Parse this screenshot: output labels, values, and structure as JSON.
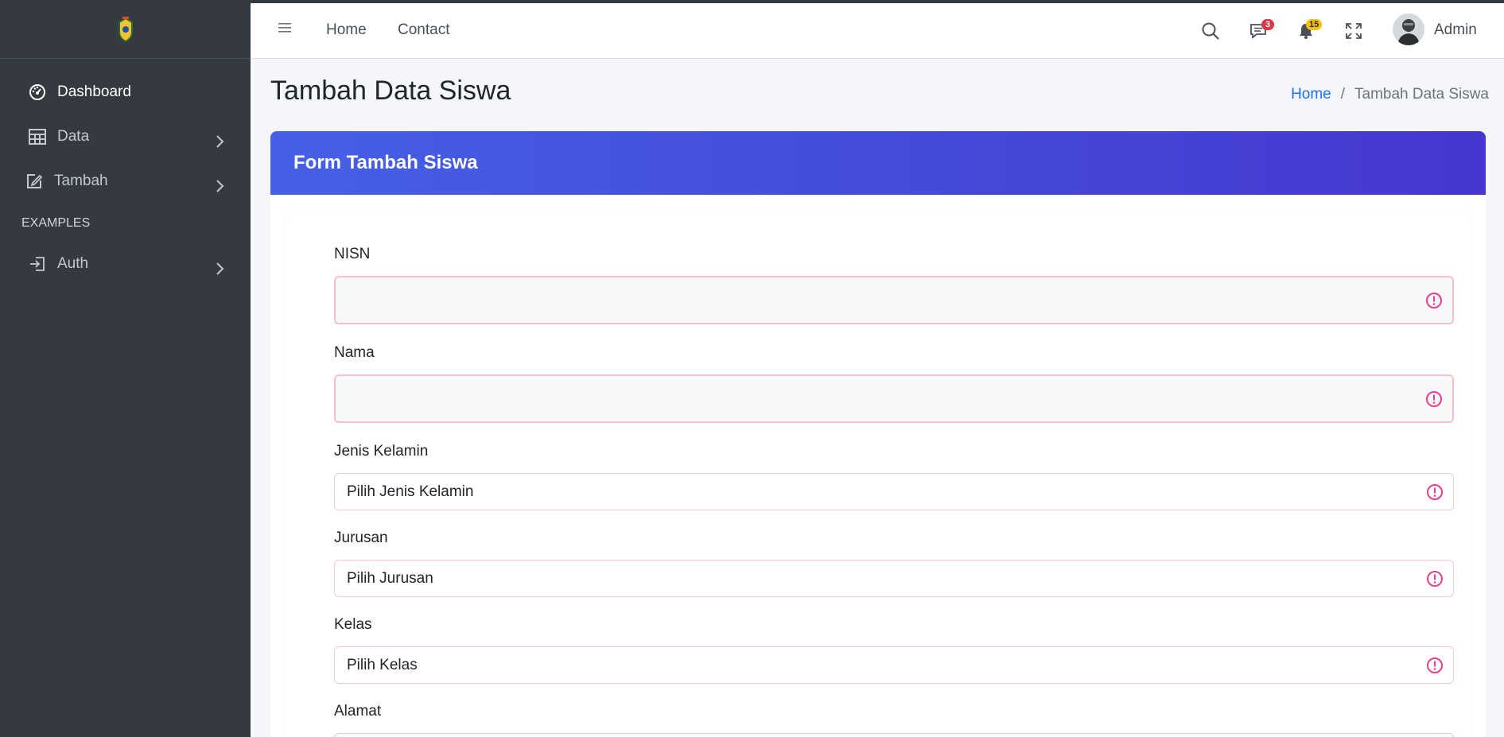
{
  "navbar": {
    "links": [
      "Home",
      "Contact"
    ],
    "messages_count": "3",
    "notifications_count": "15",
    "user_name": "Admin"
  },
  "sidebar": {
    "items": [
      {
        "label": "Dashboard",
        "icon": "dashboard-gauge-icon"
      },
      {
        "label": "Data",
        "icon": "table-icon"
      },
      {
        "label": "Tambah",
        "icon": "edit-icon"
      }
    ],
    "section_header": "EXAMPLES",
    "auth": {
      "label": "Auth",
      "icon": "login-icon"
    }
  },
  "page": {
    "title": "Tambah Data Siswa",
    "breadcrumb": {
      "home": "Home",
      "separator": "/",
      "current": "Tambah Data Siswa"
    }
  },
  "form": {
    "card_title": "Form Tambah Siswa",
    "fields": {
      "nisn_label": "NISN",
      "nama_label": "Nama",
      "jenis_kelamin_label": "Jenis Kelamin",
      "jenis_kelamin_value": "Pilih Jenis Kelamin",
      "jurusan_label": "Jurusan",
      "jurusan_value": "Pilih Jurusan",
      "kelas_label": "Kelas",
      "kelas_value": "Pilih Kelas",
      "alamat_label": "Alamat"
    }
  },
  "colors": {
    "sidebar_bg": "#343a40",
    "card_header_start": "#4560e6",
    "card_header_end": "#4537d0",
    "invalid": "#e83e8c",
    "breadcrumb_link": "#1a73e8"
  }
}
